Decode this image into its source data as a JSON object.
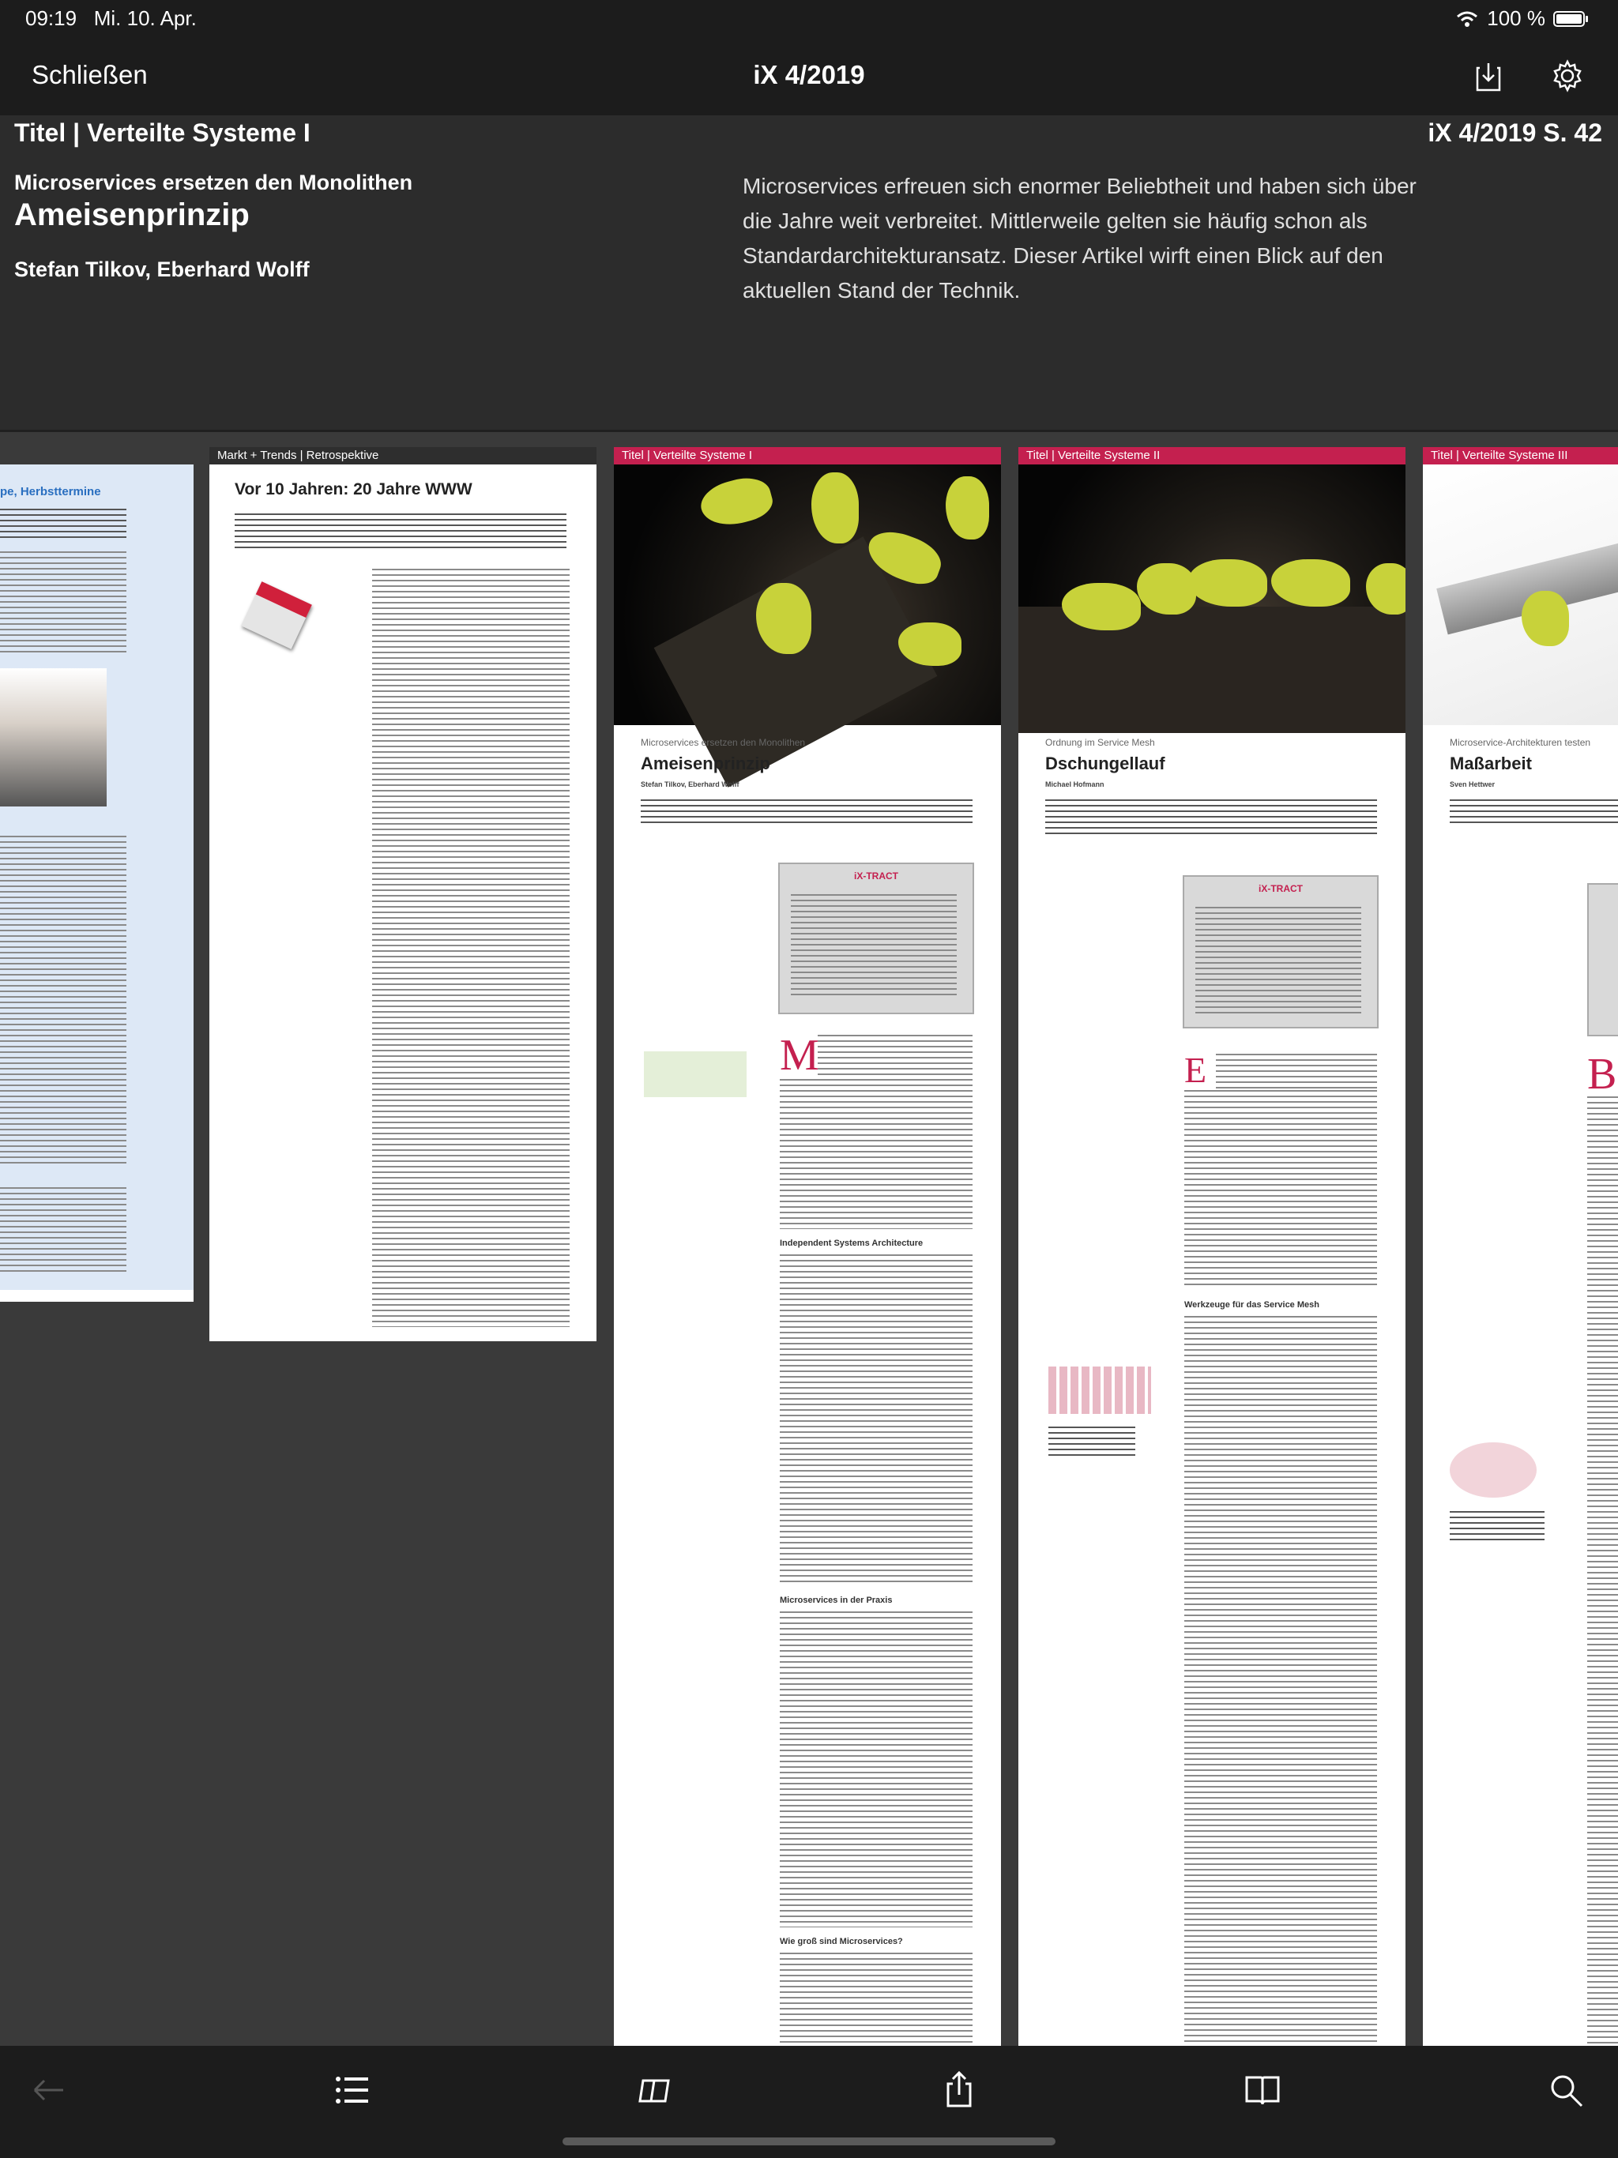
{
  "status": {
    "time": "09:19",
    "date": "Mi. 10. Apr.",
    "battery": "100 %"
  },
  "nav": {
    "close_label": "Schließen",
    "title": "iX 4/2019",
    "icons": [
      "download-icon",
      "gear-icon"
    ]
  },
  "info": {
    "section": "Titel | Verteilte Systeme I",
    "page_ref": "iX 4/2019 S. 42",
    "kicker": "Microservices ersetzen den Monolithen",
    "headline": "Ameisenprinzip",
    "authors": "Stefan Tilkov, Eberhard Wolff",
    "teaser": "Microservices erfreuen sich enormer Beliebtheit und haben sich über die Jahre weit verbreitet. Mittlerweile gelten sie häufig schon als Standardarchitekturansatz. Dieser Artikel wirft einen Blick auf den aktuellen Stand der Technik."
  },
  "pages": [
    {
      "label": "",
      "title": "pe, Herbsttermine"
    },
    {
      "label": "Markt + Trends | Retrospektive",
      "title": "Vor 10 Jahren: 20 Jahre WWW"
    },
    {
      "label": "Titel | Verteilte Systeme I",
      "kicker": "Microservices ersetzen den Monolithen",
      "title": "Ameisenprinzip",
      "authors": "Stefan Tilkov, Eberhard Wolff",
      "abstract_title": "iX-TRACT",
      "dropcap": "M",
      "subheads": [
        "Independent Systems Architecture",
        "Microservices in der Praxis",
        "Wie groß sind Microservices?"
      ]
    },
    {
      "label": "Titel | Verteilte Systeme II",
      "kicker": "Ordnung im Service Mesh",
      "title": "Dschungellauf",
      "authors": "Michael Hofmann",
      "abstract_title": "iX-TRACT",
      "dropcap": "E",
      "subheads": [
        "Werkzeuge für das Service Mesh"
      ]
    },
    {
      "label": "Titel | Verteilte Systeme III",
      "kicker": "Microservice-Architekturen testen",
      "title": "Maßarbeit",
      "authors": "Sven Hettwer",
      "dropcap": "B"
    }
  ],
  "toolbar": {
    "icons": [
      "back-arrow-icon",
      "list-icon",
      "page-view-icon",
      "share-icon",
      "book-icon",
      "search-icon"
    ]
  }
}
